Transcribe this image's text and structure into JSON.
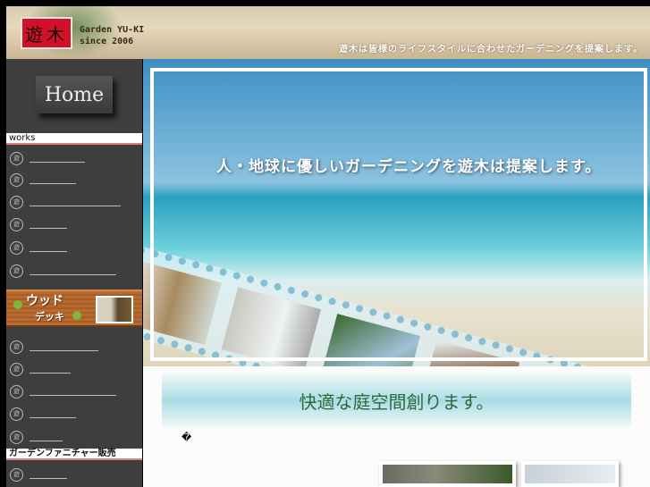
{
  "header": {
    "logo_text": "遊木",
    "brand_line1": "Garden YU-KI",
    "brand_line2": "since 2006",
    "tagline": "遊木は皆様のライフスタイルに合わせたガーデニングを提案します。"
  },
  "sidebar": {
    "home_label": "Home",
    "section_works": "works",
    "wood_deck_line1": "ウッド",
    "wood_deck_line2": "デッキ",
    "section_furniture": "ガーデンファニチャー販売"
  },
  "hero": {
    "title": "人・地球に優しいガーデニングを遊木は提案します。"
  },
  "main": {
    "banner": "快適な庭空間創ります。",
    "glyph": "�"
  }
}
